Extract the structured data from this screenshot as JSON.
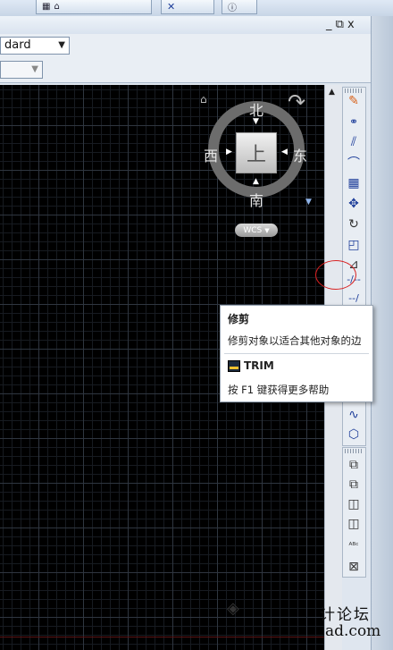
{
  "window": {
    "restore_glyph": "_ ⧉ x"
  },
  "toolbar_top": {
    "chip1": "",
    "chip2": ""
  },
  "styles": {
    "textstyle_value": "dard",
    "second_value": ""
  },
  "viewcube": {
    "north": "北",
    "south": "南",
    "east": "东",
    "west": "西",
    "face": "上",
    "ucs_label": "WCS"
  },
  "tooltip": {
    "title": "修剪",
    "description": "修剪对象以适合其他对象的边",
    "command": "TRIM",
    "help": "按 F1 键获得更多帮助"
  },
  "tools_upper": [
    "line-icon",
    "copy-icon",
    "mirror-icon",
    "offset-icon",
    "array-icon",
    "move-icon",
    "rotate-icon",
    "scale-icon",
    "stretch-icon",
    "trim-icon",
    "extend-icon"
  ],
  "tools_lower": [
    "blend-icon",
    "explode-icon"
  ],
  "draworder_tools": [
    "bring-front-icon",
    "send-back-icon",
    "bring-above-icon",
    "send-under-icon",
    "text-front-icon",
    "hatch-back-icon"
  ],
  "watermark": {
    "text": "计论坛",
    "url": "ad.com"
  },
  "colors": {
    "canvas_bg": "#000000",
    "tooltip_bg": "#ffffff",
    "highlight_circle": "#d82020"
  }
}
